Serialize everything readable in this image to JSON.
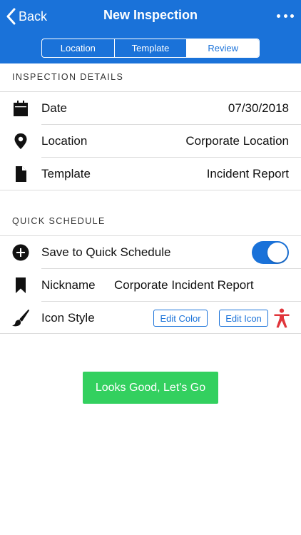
{
  "nav": {
    "back_label": "Back",
    "title": "New Inspection",
    "more_icon": "ellipsis-icon",
    "tabs": [
      {
        "label": "Location",
        "active": false
      },
      {
        "label": "Template",
        "active": false
      },
      {
        "label": "Review",
        "active": true
      }
    ]
  },
  "details": {
    "header": "INSPECTION DETAILS",
    "rows": [
      {
        "icon": "calendar-icon",
        "label": "Date",
        "value": "07/30/2018"
      },
      {
        "icon": "location-pin-icon",
        "label": "Location",
        "value": "Corporate Location"
      },
      {
        "icon": "document-icon",
        "label": "Template",
        "value": "Incident Report"
      }
    ]
  },
  "quick_schedule": {
    "header": "QUICK SCHEDULE",
    "save": {
      "icon": "plus-circle-icon",
      "label": "Save to Quick Schedule",
      "enabled": true
    },
    "nickname": {
      "icon": "bookmark-icon",
      "label": "Nickname",
      "value": "Corporate Incident Report"
    },
    "icon_style": {
      "icon": "paintbrush-icon",
      "label": "Icon Style",
      "edit_color_label": "Edit Color",
      "edit_icon_label": "Edit Icon",
      "preview_icon": "person-icon",
      "preview_color": "#e0353b"
    }
  },
  "cta_label": "Looks Good, Let's Go",
  "colors": {
    "brand_blue": "#1a72d9",
    "cta_green": "#33d05f",
    "separator": "#dcdcdc"
  }
}
